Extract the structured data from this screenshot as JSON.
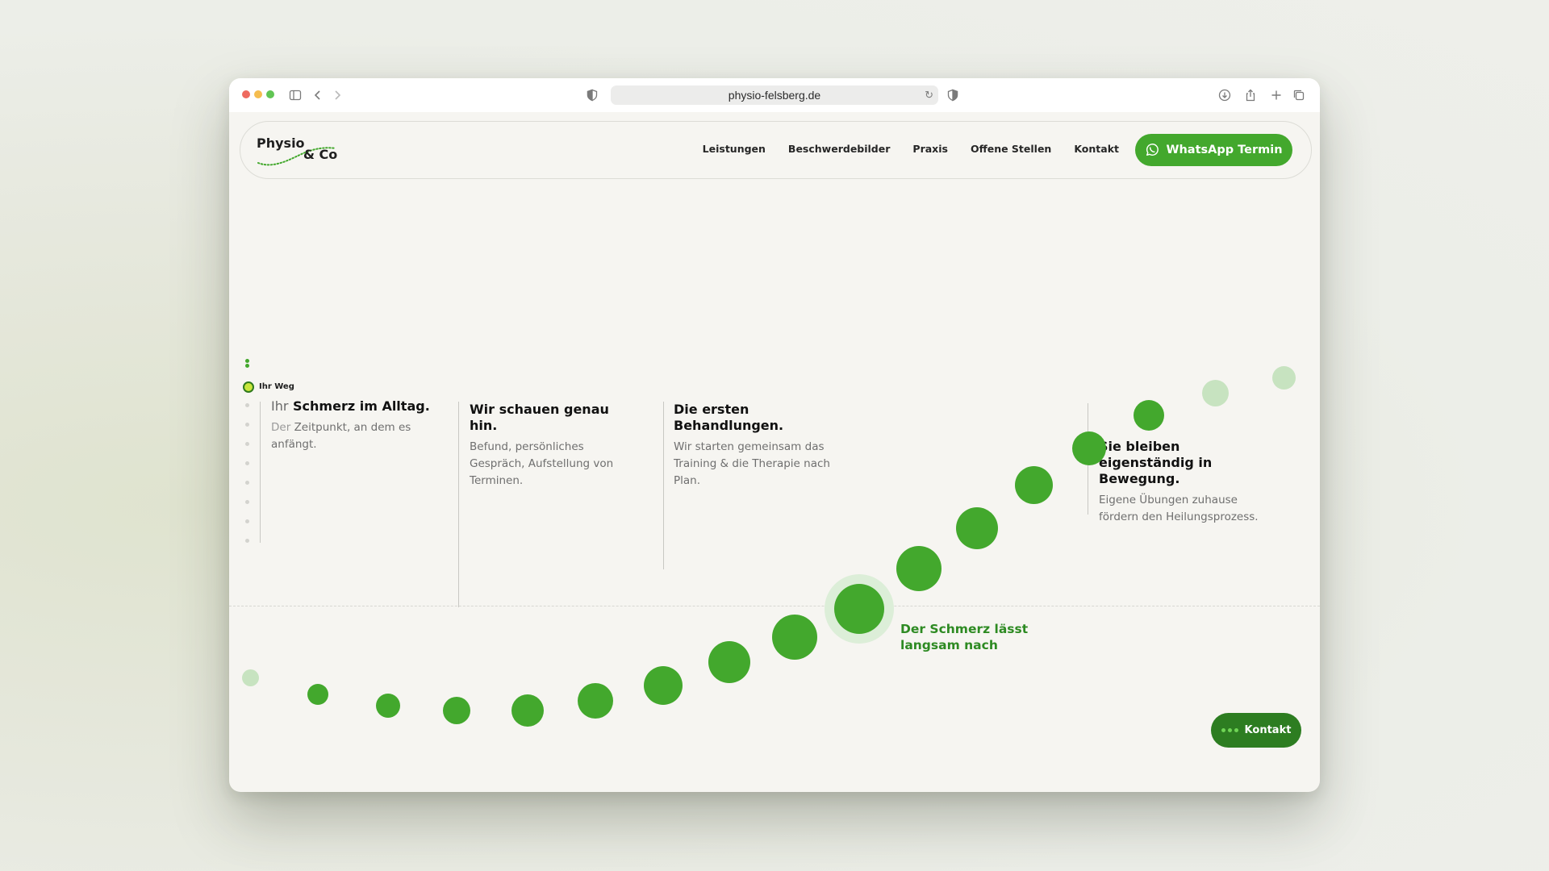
{
  "browser": {
    "url": "physio-felsberg.de",
    "traffic_colors": [
      "#ee6a5f",
      "#f5bd4f",
      "#61c554"
    ]
  },
  "header": {
    "logo_text_1": "Physio",
    "logo_text_2": "& Co",
    "nav_items": [
      "Leistungen",
      "Beschwerdebilder",
      "Praxis",
      "Offene Stellen",
      "Kontakt"
    ],
    "whatsapp_button": "WhatsApp Termin"
  },
  "journey": {
    "stage_label": "Ihr Weg",
    "step1": {
      "title_muted": "Ihr",
      "title_bold": "Schmerz im Alltag.",
      "text_muted": "Der",
      "text": "Zeitpunkt, an dem es anfängt."
    },
    "step2": {
      "title": "Wir schauen genau hin.",
      "text": "Befund, persönliches Gespräch, Aufstellung von Terminen."
    },
    "step3": {
      "title": "Die ersten Behandlungen.",
      "text": "Wir starten gemeinsam das Training & die Therapie nach Plan."
    },
    "step4": {
      "title": "Sie bleiben eigenständig in Bewegung.",
      "text": "Eigene Übungen zuhause fördern den Heilungsprozess."
    },
    "callout": "Der Schmerz lässt langsam nach"
  },
  "floating": {
    "kontakt_button": "Kontakt"
  },
  "colors": {
    "brand_green": "#43a82d",
    "dark_green": "#2d7d21",
    "pale_green": "#c7e3c0",
    "page_bg": "#f6f5f1"
  }
}
